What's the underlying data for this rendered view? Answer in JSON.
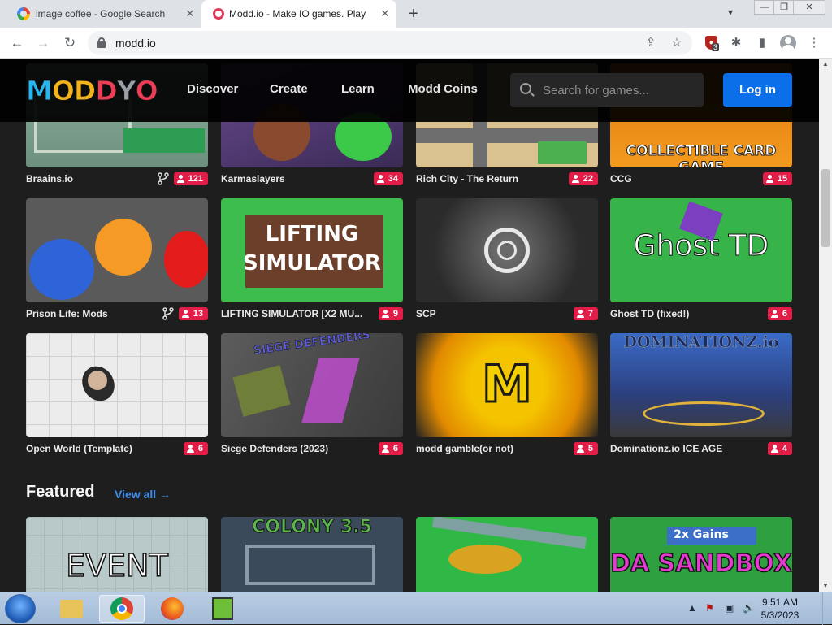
{
  "browser": {
    "tabs": [
      {
        "title": "image coffee - Google Search",
        "favicon": "google-icon"
      },
      {
        "title": "Modd.io - Make IO games. Play I",
        "favicon": "modd-icon"
      }
    ],
    "url": "modd.io",
    "extension_badge": "3"
  },
  "site": {
    "logo": "MODDIO",
    "nav": [
      "Discover",
      "Create",
      "Learn",
      "Modd Coins"
    ],
    "search_placeholder": "Search for games...",
    "login_label": "Log in"
  },
  "games": [
    {
      "name": "Braains.io",
      "players": "121",
      "forked": true
    },
    {
      "name": "Karmaslayers",
      "players": "34",
      "forked": false
    },
    {
      "name": "Rich City - The Return",
      "players": "22",
      "forked": false
    },
    {
      "name": "CCG",
      "players": "15",
      "forked": false,
      "thumb_text": "COLLECTIBLE CARD GAME"
    },
    {
      "name": "Prison Life: Mods",
      "players": "13",
      "forked": true
    },
    {
      "name": "LIFTING SIMULATOR [X2 MU...",
      "players": "9",
      "forked": false,
      "thumb_text": "LIFTING SIMULATOR"
    },
    {
      "name": "SCP",
      "players": "7",
      "forked": false
    },
    {
      "name": "Ghost TD (fixed!)",
      "players": "6",
      "forked": false,
      "thumb_text": "Ghost TD"
    },
    {
      "name": "Open World (Template)",
      "players": "6",
      "forked": false
    },
    {
      "name": "Siege Defenders (2023)",
      "players": "6",
      "forked": false,
      "thumb_text": "SIEGE DEFENDERS"
    },
    {
      "name": "modd gamble(or not)",
      "players": "5",
      "forked": false,
      "thumb_text": "M"
    },
    {
      "name": "Dominationz.io ICE AGE",
      "players": "4",
      "forked": false,
      "thumb_text": "DOMINATIONZ.io"
    }
  ],
  "featured": {
    "title": "Featured",
    "view_all": "View all →",
    "thumbs": [
      {
        "thumb_text": "EVENT"
      },
      {
        "thumb_text": "COLONY 3.5"
      },
      {
        "thumb_text": ""
      },
      {
        "thumb_text": "2x Gains",
        "thumb_text_2": "DA SANDBOX"
      }
    ]
  },
  "taskbar": {
    "time": "9:51 AM",
    "date": "5/3/2023"
  }
}
